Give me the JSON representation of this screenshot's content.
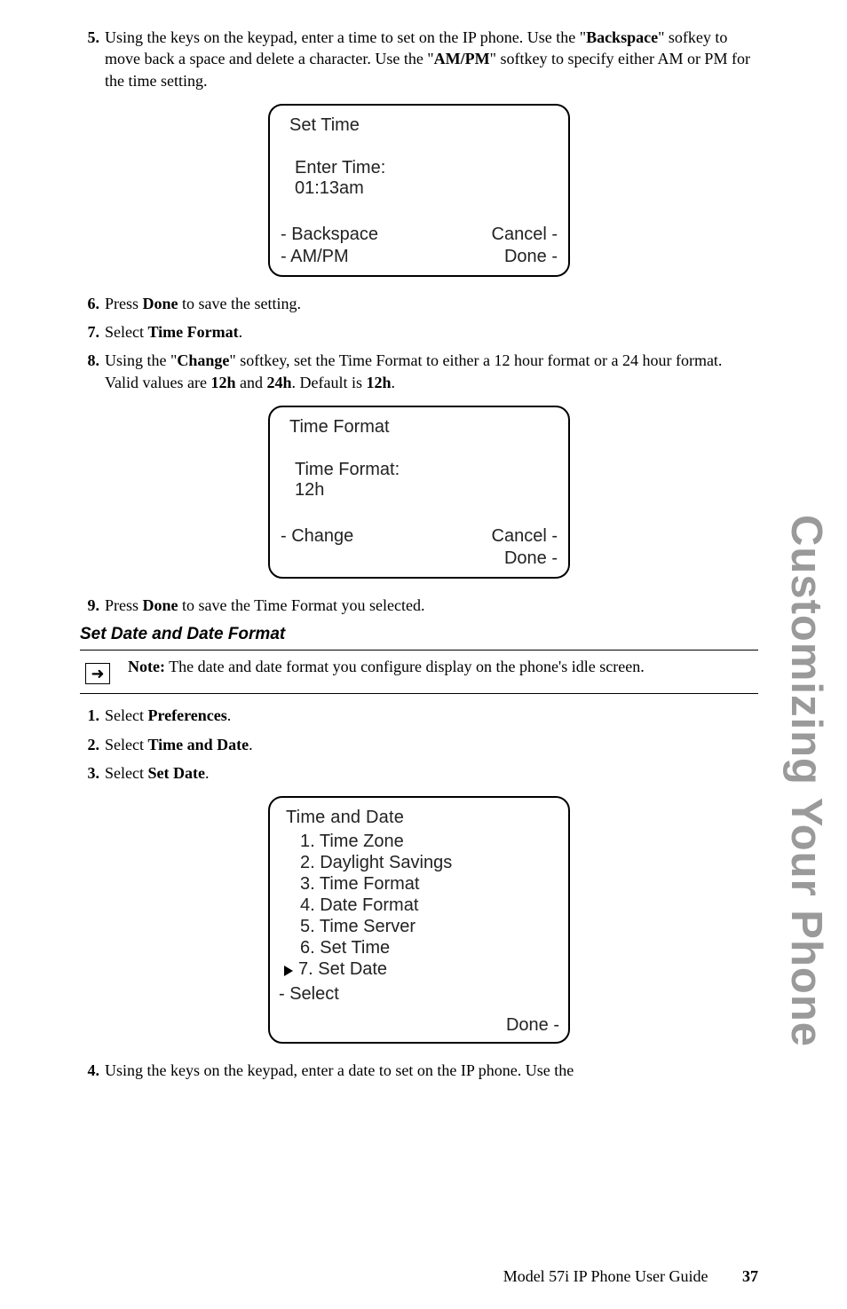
{
  "steps": {
    "s5": {
      "num": "5.",
      "text_pre": "Using the keys on the keypad, enter a time to set on the IP phone. Use the \"",
      "b1": "Backspace",
      "mid1": "\" sofkey to move back a space and delete a character. Use the \"",
      "b2": "AM/PM",
      "mid2": "\" softkey to specify either AM or PM for the time setting."
    },
    "s6": {
      "num": "6.",
      "t1": "Press ",
      "b1": "Done",
      "t2": " to save the setting."
    },
    "s7": {
      "num": "7.",
      "t1": "Select ",
      "b1": "Time Format",
      "t2": "."
    },
    "s8": {
      "num": "8.",
      "t1": "Using the \"",
      "b1": "Change",
      "t2": "\" softkey, set the Time Format to either a 12 hour format or a 24 hour format. Valid values are ",
      "b2": "12h",
      "t3": " and ",
      "b3": "24h",
      "t4": ". Default is ",
      "b4": "12h",
      "t5": "."
    },
    "s9": {
      "num": "9.",
      "t1": "Press ",
      "b1": "Done",
      "t2": " to save the Time Format you selected."
    },
    "s1b": {
      "num": "1.",
      "t1": "Select ",
      "b1": "Preferences",
      "t2": "."
    },
    "s2b": {
      "num": "2.",
      "t1": "Select ",
      "b1": "Time and Date",
      "t2": "."
    },
    "s3b": {
      "num": "3.",
      "t1": "Select ",
      "b1": "Set Date",
      "t2": "."
    },
    "s4b": {
      "num": "4.",
      "text": "Using the keys on the keypad, enter a date to set on the IP phone. Use the"
    }
  },
  "screen1": {
    "title": "Set Time",
    "l1": "Enter Time:",
    "l2": "01:13am",
    "sk_bksp": "- Backspace",
    "sk_ampm": "- AM/PM",
    "sk_cancel": "Cancel -",
    "sk_done": "Done -"
  },
  "screen2": {
    "title": "Time Format",
    "l1": "Time Format:",
    "l2": "12h",
    "sk_change": "- Change",
    "sk_cancel": "Cancel -",
    "sk_done": "Done -"
  },
  "screen3": {
    "title": "Time and Date",
    "i1": "1. Time Zone",
    "i2": "2. Daylight Savings",
    "i3": "3. Time Format",
    "i4": "4. Date Format",
    "i5": "5. Time Server",
    "i6": "6. Set Time",
    "i7": "7. Set Date",
    "sk_select": "- Select",
    "sk_done": "Done -"
  },
  "subhead": "Set Date and Date Format",
  "note": {
    "label": "Note:",
    "text": " The date and date format you configure display on the phone's idle screen."
  },
  "note_arrow": "➜",
  "side_tab": "Customizing Your Phone",
  "footer": {
    "title": "Model 57i IP Phone User Guide",
    "page": "37"
  }
}
